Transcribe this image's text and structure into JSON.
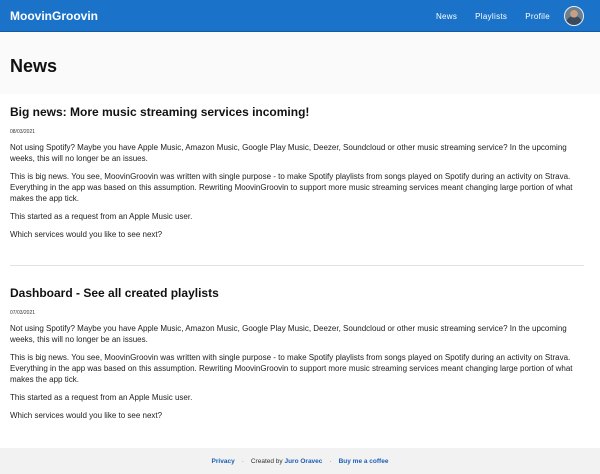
{
  "header": {
    "brand": "MoovinGroovin",
    "nav": [
      "News",
      "Playlists",
      "Profile"
    ]
  },
  "page": {
    "title": "News"
  },
  "articles": [
    {
      "title": "Big news: More music streaming services incoming!",
      "date": "08/03/2021",
      "paragraphs": [
        "Not using Spotify? Maybe you have Apple Music, Amazon Music, Google Play Music, Deezer, Soundcloud or other music streaming service? In the upcoming weeks, this will no longer be an issues.",
        "This is big news. You see, MoovinGroovin was written with single purpose - to make Spotify playlists from songs played on Spotify during an activity on Strava. Everything in the app was based on this assumption. Rewriting MoovinGroovin to support more music streaming services meant changing large portion of what makes the app tick.",
        "This started as a request from an Apple Music user.",
        "Which services would you like to see next?"
      ]
    },
    {
      "title": "Dashboard - See all created playlists",
      "date": "07/03/2021",
      "paragraphs": [
        "Not using Spotify? Maybe you have Apple Music, Amazon Music, Google Play Music, Deezer, Soundcloud or other music streaming service? In the upcoming weeks, this will no longer be an issues.",
        "This is big news. You see, MoovinGroovin was written with single purpose - to make Spotify playlists from songs played on Spotify during an activity on Strava. Everything in the app was based on this assumption. Rewriting MoovinGroovin to support more music streaming services meant changing large portion of what makes the app tick.",
        "This started as a request from an Apple Music user.",
        "Which services would you like to see next?"
      ]
    }
  ],
  "footer": {
    "privacy": "Privacy",
    "created_by": "Created by",
    "author": "Juro Oravec",
    "coffee": "Buy me a coffee",
    "separator": "·"
  },
  "colors": {
    "topbar": "#1a73c9",
    "link": "#1a5fb4"
  }
}
